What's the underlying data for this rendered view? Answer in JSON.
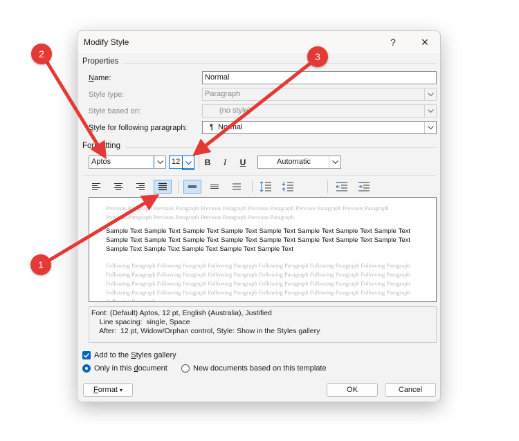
{
  "dialog": {
    "title": "Modify Style",
    "help": "?",
    "close": "×"
  },
  "properties": {
    "heading": "Properties",
    "name_label": "Name:",
    "name_value": "Normal",
    "style_type_label": "Style type:",
    "style_type_value": "Paragraph",
    "based_on_label": "Style based on:",
    "based_on_value": "(no style)",
    "following_label": "Style for following paragraph:",
    "following_icon": "¶",
    "following_value": "Normal"
  },
  "formatting": {
    "heading": "Formatting",
    "font": "Aptos",
    "size": "12",
    "bold": "B",
    "italic": "I",
    "underline": "U",
    "color": "Automatic"
  },
  "preview": {
    "previous": "Previous Paragraph Previous Paragraph Previous Paragraph Previous Paragraph Previous Paragraph Previous Paragraph Previous Paragraph Previous Paragraph Previous Paragraph Previous Paragraph",
    "sample": "Sample Text Sample Text Sample Text Sample Text Sample Text Sample Text Sample Text Sample Text Sample Text Sample Text Sample Text Sample Text Sample Text Sample Text Sample Text Sample Text Sample Text Sample Text Sample Text Sample Text Sample Text",
    "following": "Following Paragraph Following Paragraph Following Paragraph Following Paragraph Following Paragraph Following Paragraph Following Paragraph Following Paragraph Following Paragraph Following Paragraph Following Paragraph Following Paragraph Following Paragraph Following Paragraph Following Paragraph Following Paragraph Following Paragraph Following Paragraph Following Paragraph Following Paragraph Following Paragraph Following Paragraph Following Paragraph Following Paragraph Following Paragraph"
  },
  "description": {
    "line1": "Font: (Default) Aptos, 12 pt, English (Australia), Justified",
    "line2": "    Line spacing:  single, Space",
    "line3": "    After:  12 pt, Widow/Orphan control, Style: Show in the Styles gallery"
  },
  "options": {
    "add_gallery": "Add to the Styles gallery",
    "add_gallery_checked": true,
    "only_document": "Only in this document",
    "new_documents": "New documents based on this template",
    "selected": "only_document"
  },
  "buttons": {
    "format": "Format",
    "format_arrow": "▾",
    "ok": "OK",
    "cancel": "Cancel"
  },
  "callouts": [
    {
      "number": "1"
    },
    {
      "number": "2"
    },
    {
      "number": "3"
    }
  ],
  "colors": {
    "accent": "#0067c0",
    "callout": "#e53935",
    "selected_button": "#cfe3f7"
  }
}
